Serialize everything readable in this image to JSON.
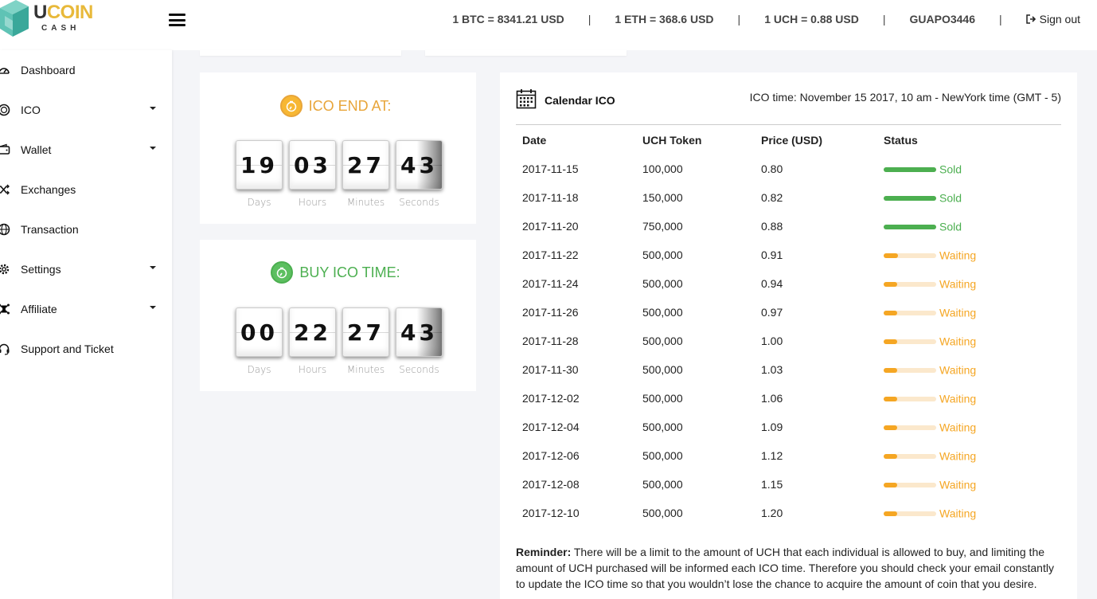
{
  "brand": {
    "name_part1": "U",
    "name_part2": "COIN",
    "sub": "CASH",
    "colors": {
      "accent": "#e8b93a",
      "teal": "#5fc3b5"
    }
  },
  "header": {
    "menu_icon": "hamburger-icon",
    "rates": {
      "btc": "1 BTC = 8341.21 USD",
      "eth": "1 ETH = 368.6 USD",
      "uch": "1 UCH = 0.88 USD"
    },
    "separator": "|",
    "username": "GUAPO3446",
    "signout_label": "Sign out"
  },
  "sidebar": {
    "items": [
      {
        "label": "Dashboard",
        "icon": "dashboard-icon"
      },
      {
        "label": "ICO",
        "icon": "coin-icon",
        "has_submenu": true
      },
      {
        "label": "Wallet",
        "icon": "wallet-icon",
        "has_submenu": true
      },
      {
        "label": "Exchanges",
        "icon": "shuffle-icon"
      },
      {
        "label": "Transaction",
        "icon": "globe-icon"
      },
      {
        "label": "Settings",
        "icon": "gear-icon",
        "has_submenu": true
      },
      {
        "label": "Affiliate",
        "icon": "network-icon",
        "has_submenu": true
      },
      {
        "label": "Support and Ticket",
        "icon": "headset-icon"
      }
    ]
  },
  "ico_end": {
    "title": "ICO END AT:",
    "color": "#e8a53a",
    "days": "19",
    "hours": "03",
    "minutes": "27",
    "seconds": "43"
  },
  "buy_ico": {
    "title": "BUY ICO TIME:",
    "color": "#4caf50",
    "days": "00",
    "hours": "22",
    "minutes": "27",
    "seconds": "43"
  },
  "units": {
    "days": "Days",
    "hours": "Hours",
    "minutes": "Minutes",
    "seconds": "Seconds"
  },
  "calendar": {
    "title": "Calendar ICO",
    "ico_time": "ICO time: November 15 2017, 10 am - NewYork time (GMT - 5)",
    "columns": [
      "Date",
      "UCH Token",
      "Price (USD)",
      "Status"
    ],
    "status_colors": {
      "Sold": "#4caf50",
      "Waiting": "#f5a623"
    },
    "rows": [
      {
        "date": "2017-11-15",
        "tokens": "100,000",
        "price": "0.80",
        "status": "Sold",
        "progress": 1.0
      },
      {
        "date": "2017-11-18",
        "tokens": "150,000",
        "price": "0.82",
        "status": "Sold",
        "progress": 1.0
      },
      {
        "date": "2017-11-20",
        "tokens": "750,000",
        "price": "0.88",
        "status": "Sold",
        "progress": 1.0
      },
      {
        "date": "2017-11-22",
        "tokens": "500,000",
        "price": "0.91",
        "status": "Waiting",
        "progress": 0.28
      },
      {
        "date": "2017-11-24",
        "tokens": "500,000",
        "price": "0.94",
        "status": "Waiting",
        "progress": 0.25
      },
      {
        "date": "2017-11-26",
        "tokens": "500,000",
        "price": "0.97",
        "status": "Waiting",
        "progress": 0.25
      },
      {
        "date": "2017-11-28",
        "tokens": "500,000",
        "price": "1.00",
        "status": "Waiting",
        "progress": 0.25
      },
      {
        "date": "2017-11-30",
        "tokens": "500,000",
        "price": "1.03",
        "status": "Waiting",
        "progress": 0.25
      },
      {
        "date": "2017-12-02",
        "tokens": "500,000",
        "price": "1.06",
        "status": "Waiting",
        "progress": 0.25
      },
      {
        "date": "2017-12-04",
        "tokens": "500,000",
        "price": "1.09",
        "status": "Waiting",
        "progress": 0.25
      },
      {
        "date": "2017-12-06",
        "tokens": "500,000",
        "price": "1.12",
        "status": "Waiting",
        "progress": 0.25
      },
      {
        "date": "2017-12-08",
        "tokens": "500,000",
        "price": "1.15",
        "status": "Waiting",
        "progress": 0.25
      },
      {
        "date": "2017-12-10",
        "tokens": "500,000",
        "price": "1.20",
        "status": "Waiting",
        "progress": 0.25
      }
    ],
    "reminder_label": "Reminder:",
    "reminder_text": " There will be a limit to the amount of UCH that each individual is allowed to buy, and limiting the amount of UCH purchased will be informed each ICO time. Therefore you should check your email constantly to update the ICO time so that you wouldn’t lose the chance to acquire the amount of coin that you desire."
  }
}
